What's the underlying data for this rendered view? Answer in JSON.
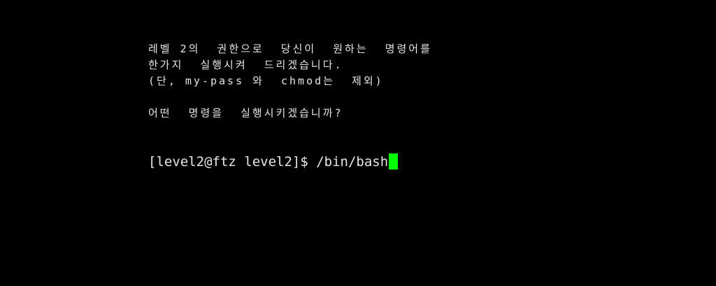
{
  "terminal": {
    "messages": [
      "레벨 2의  권한으로  당신이  원하는  명령어를",
      "한가지  실행시켜  드리겠습니다.",
      "(단, my-pass 와  chmod는  제외)",
      "어떤  명령을  실행시키겠습니까?"
    ],
    "prompt": "[level2@ftz level2]$ ",
    "command": "/bin/bash",
    "cursor_color": "#00ff00"
  }
}
